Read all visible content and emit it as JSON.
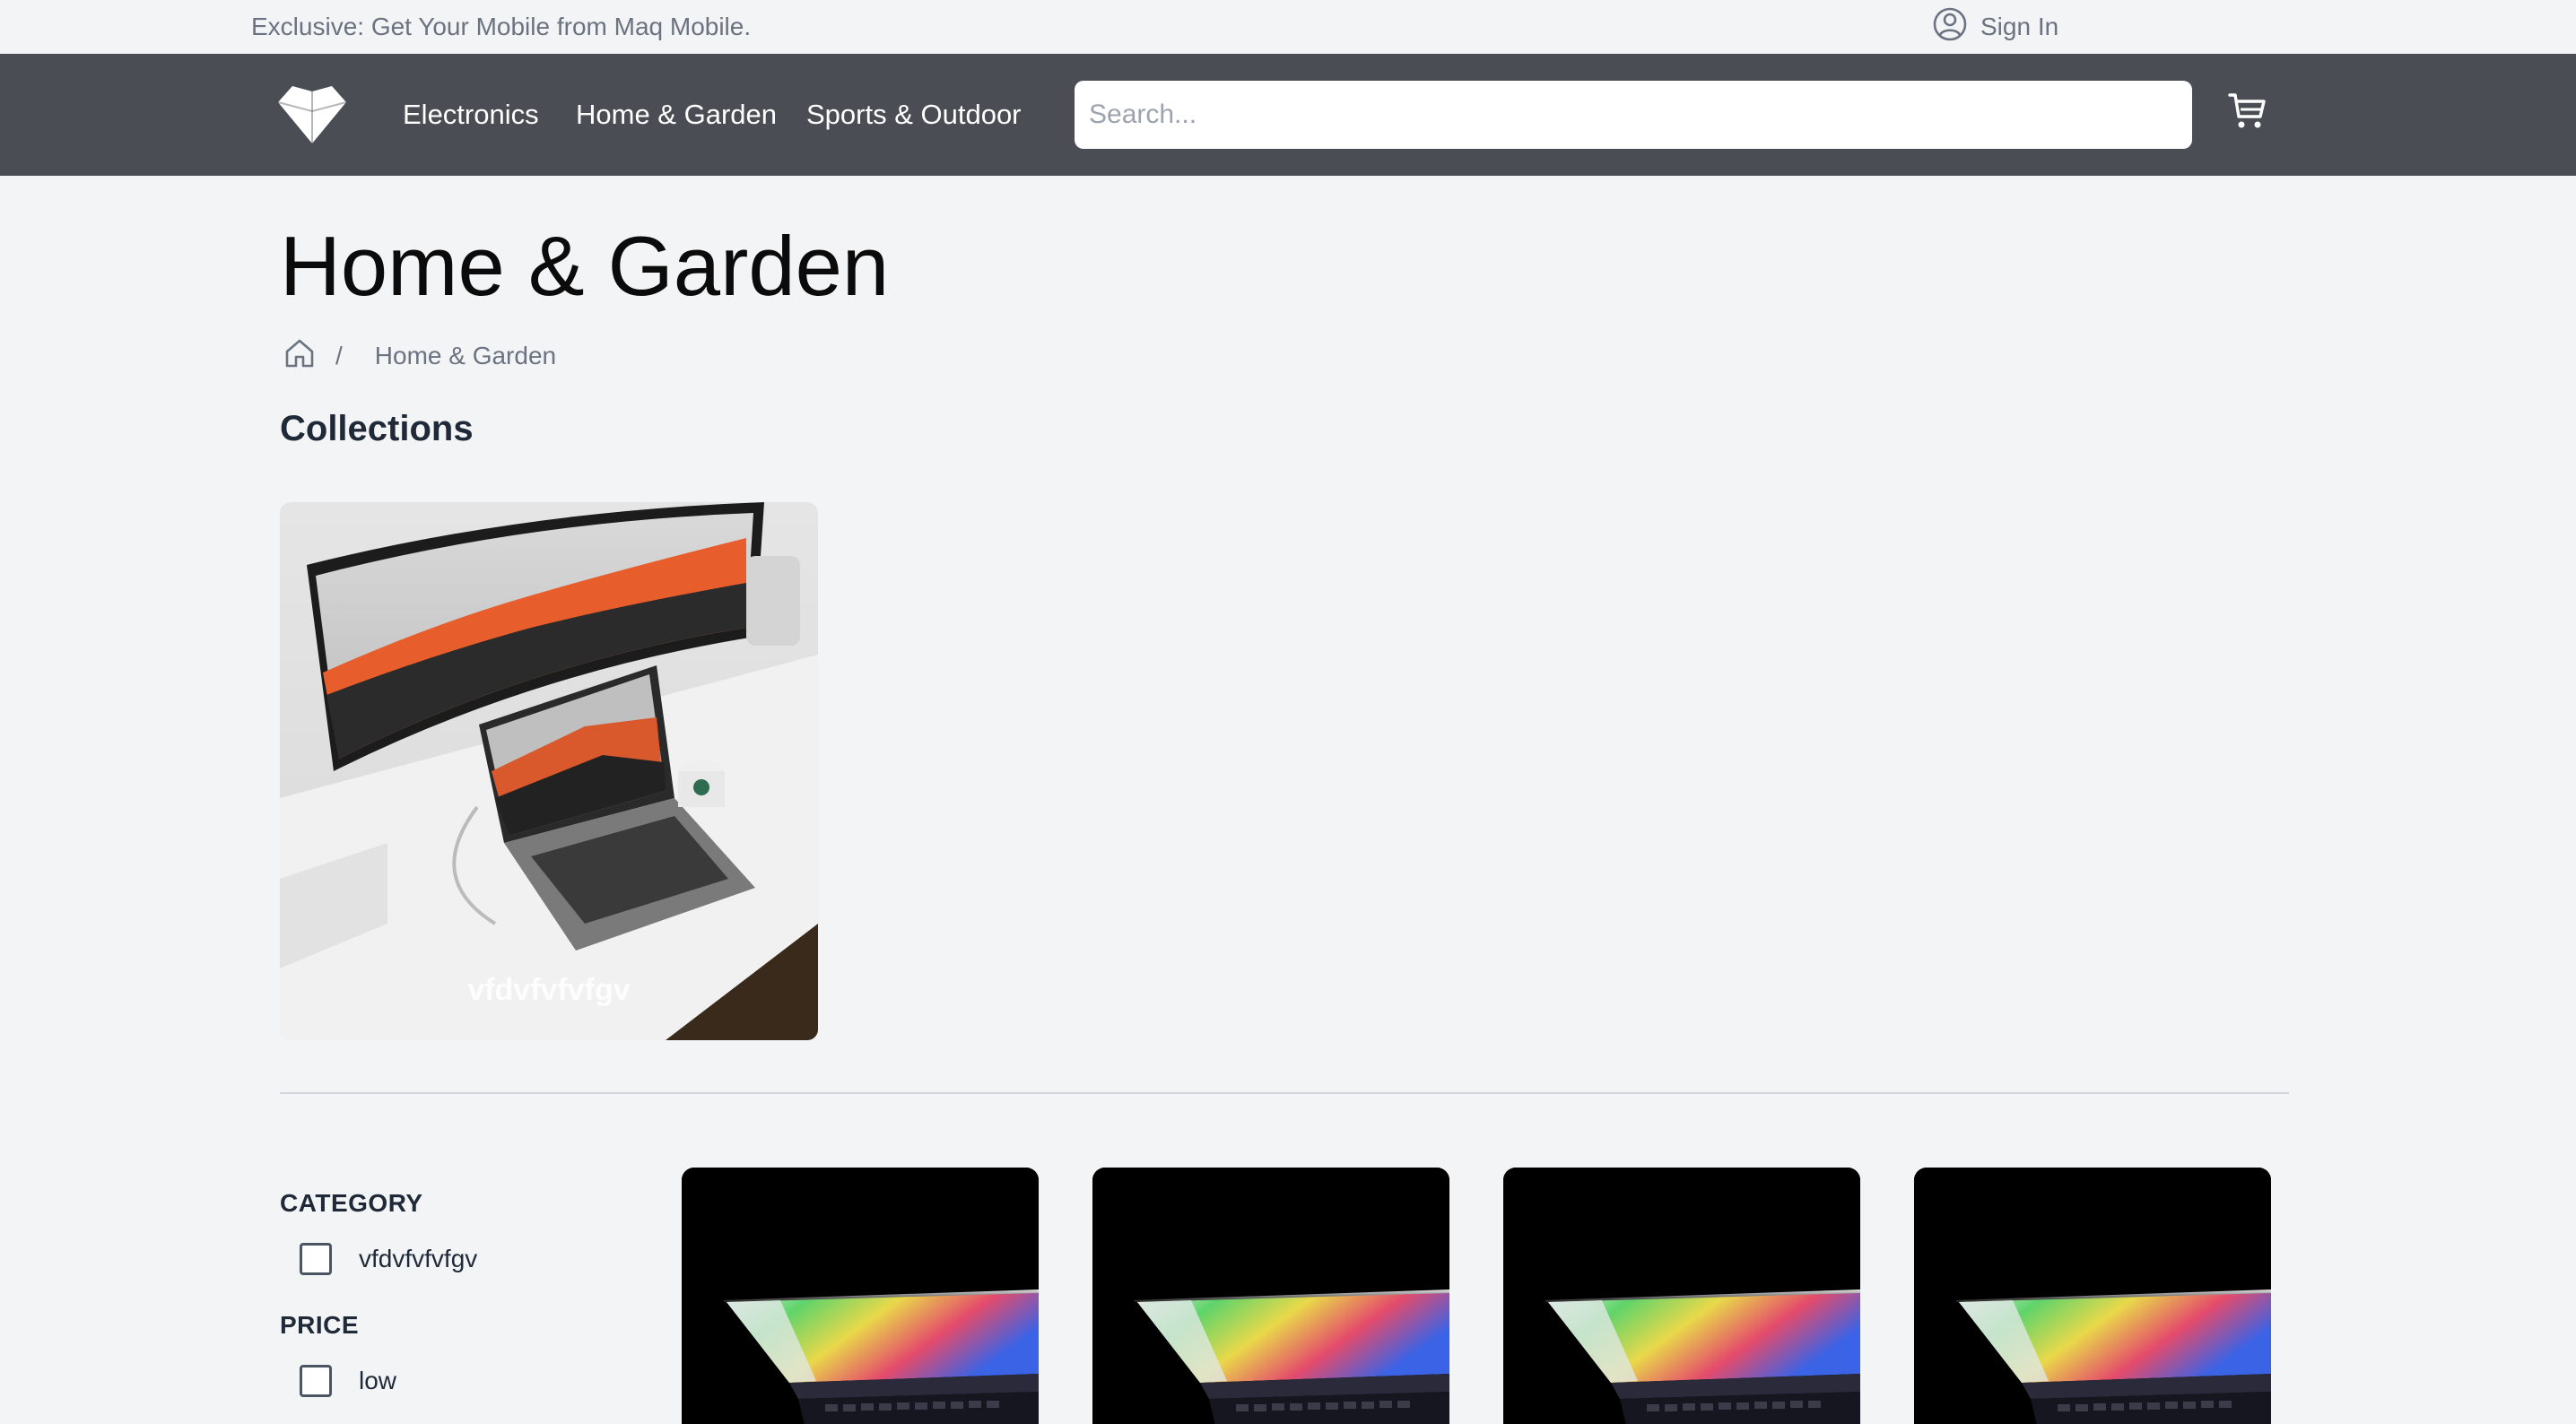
{
  "topbar": {
    "announcement": "Exclusive: Get Your Mobile from Maq Mobile.",
    "signin_label": "Sign In"
  },
  "nav": {
    "links": [
      "Electronics",
      "Home & Garden",
      "Sports & Outdoor"
    ],
    "search_placeholder": "Search..."
  },
  "page": {
    "title": "Home & Garden",
    "breadcrumb_current": "Home & Garden",
    "breadcrumb_separator": "/",
    "collections_heading": "Collections"
  },
  "collections": [
    {
      "label": "vfdvfvfvfgv"
    }
  ],
  "filters": {
    "category_heading": "CATEGORY",
    "category_options": [
      "vfdvfvfvfgv"
    ],
    "price_heading": "PRICE",
    "price_options": [
      "low"
    ]
  },
  "products_visible": 4,
  "colors": {
    "navbar": "#4b4d55",
    "background": "#f3f4f6"
  }
}
